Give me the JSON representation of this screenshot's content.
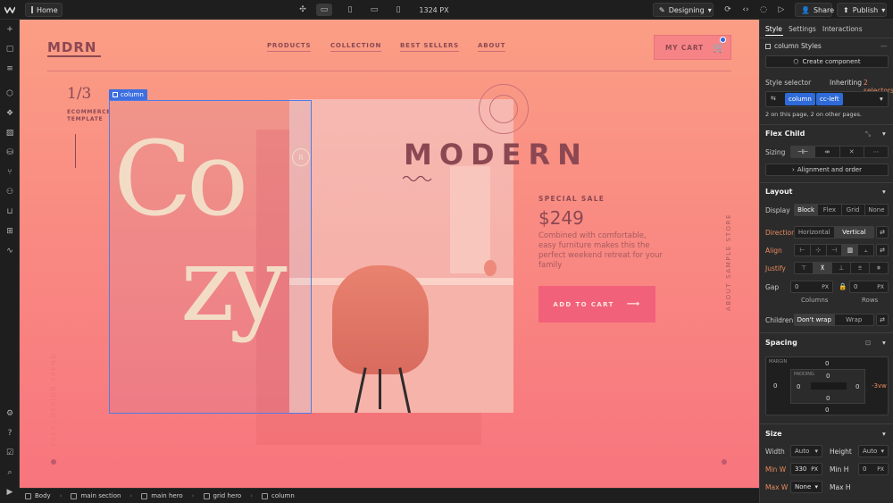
{
  "topbar": {
    "page_name": "Home",
    "width_readout": "1324 PX",
    "mode_label": "Designing",
    "share_label": "Share",
    "publish_label": "Publish"
  },
  "canvas": {
    "logo": "MDRN",
    "nav": [
      "PRODUCTS",
      "COLLECTION",
      "BEST SELLERS",
      "ABOUT"
    ],
    "cart_label": "MY CART",
    "fraction": "1/3",
    "eco_text": "ECOMMERCE TEMPLATE",
    "cozy_co": "Co",
    "cozy_zy": "zy",
    "badge_letter": "R",
    "modern": "MODERN",
    "special": "SPECIAL SALE",
    "price": "$249",
    "description": "Combined with comfortable, easy furniture makes this the perfect weekend retreat for your family",
    "add_to_cart": "ADD TO CART",
    "arrow": "⟶",
    "about_store": "ABOUT SAMPLE STORE",
    "trend": "2023—DESIGN TREND",
    "selection_tag": "column"
  },
  "breadcrumb": [
    "Body",
    "main section",
    "main hero",
    "grid hero",
    "column"
  ],
  "panel": {
    "tabs": [
      "Style",
      "Settings",
      "Interactions"
    ],
    "style_name": "column Styles",
    "create_component": "Create component",
    "style_selector_label": "Style selector",
    "inheriting": "Inheriting",
    "inheriting_count": "2 selectors",
    "chips": [
      "column",
      "cc-left"
    ],
    "usage_note": "2 on this page, 2 on other pages.",
    "flex_child": "Flex Child",
    "sizing_label": "Sizing",
    "alignment_order": "Alignment and order",
    "layout": "Layout",
    "display_label": "Display",
    "display_options": [
      "Block",
      "Flex",
      "Grid",
      "None"
    ],
    "direction_label": "Direction",
    "direction_options": [
      "Horizontal",
      "Vertical"
    ],
    "align_label": "Align",
    "justify_label": "Justify",
    "gap_label": "Gap",
    "gap_col": "0",
    "gap_row": "0",
    "gap_unit": "PX",
    "columns_label": "Columns",
    "rows_label": "Rows",
    "children_label": "Children",
    "children_options": [
      "Don't wrap",
      "Wrap"
    ],
    "spacing": "Spacing",
    "margin_label": "MARGIN",
    "padding_label": "PADDING",
    "margin_top": "0",
    "margin_left": "0",
    "margin_right": "-3vw",
    "margin_bottom": "0",
    "padding_top": "0",
    "padding_left": "0",
    "padding_right": "0",
    "padding_bottom": "0",
    "size": "Size",
    "width_label": "Width",
    "width_value": "Auto",
    "height_label": "Height",
    "height_value": "Auto",
    "minw_label": "Min W",
    "minw_value": "330",
    "minw_unit": "PX",
    "minh_label": "Min H",
    "minh_value": "0",
    "minh_unit": "PX",
    "maxw_label": "Max W",
    "maxw_value": "None",
    "maxh_label": "Max H"
  },
  "colors": {
    "canvas_top": "#fb9e85",
    "canvas_bottom": "#f8757e",
    "accent_blue": "#2f6ad9",
    "brand_text": "#8c4852",
    "button_pink": "#f1617a",
    "orange_label": "#e98a5c"
  }
}
